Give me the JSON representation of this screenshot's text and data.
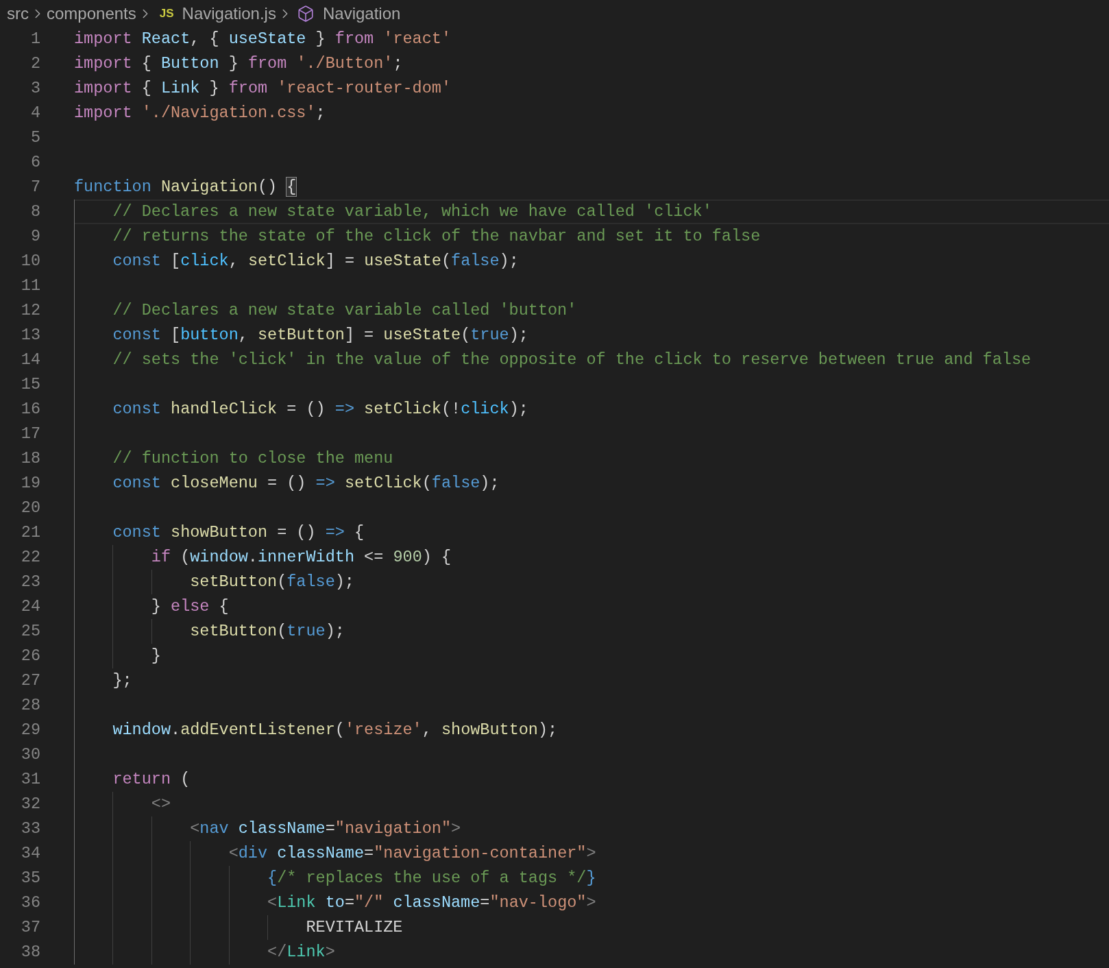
{
  "breadcrumbs": [
    {
      "kind": "folder",
      "label": "src"
    },
    {
      "kind": "folder",
      "label": "components"
    },
    {
      "kind": "file",
      "badge": "JS",
      "label": "Navigation.js"
    },
    {
      "kind": "symbol",
      "label": "Navigation"
    }
  ],
  "lines": [
    {
      "number": "1",
      "current": false,
      "tokens": [
        {
          "kind": "keyword",
          "text": "import "
        },
        {
          "kind": "variable",
          "text": "React"
        },
        {
          "kind": "plain",
          "text": ", { "
        },
        {
          "kind": "variable",
          "text": "useState"
        },
        {
          "kind": "plain",
          "text": " } "
        },
        {
          "kind": "keyword",
          "text": "from "
        },
        {
          "kind": "string",
          "text": "'react'"
        }
      ]
    },
    {
      "number": "2",
      "current": false,
      "tokens": [
        {
          "kind": "keyword",
          "text": "import "
        },
        {
          "kind": "plain",
          "text": "{ "
        },
        {
          "kind": "variable",
          "text": "Button"
        },
        {
          "kind": "plain",
          "text": " } "
        },
        {
          "kind": "keyword",
          "text": "from "
        },
        {
          "kind": "string",
          "text": "'./Button'"
        },
        {
          "kind": "plain",
          "text": ";"
        }
      ]
    },
    {
      "number": "3",
      "current": false,
      "tokens": [
        {
          "kind": "keyword",
          "text": "import "
        },
        {
          "kind": "plain",
          "text": "{ "
        },
        {
          "kind": "variable",
          "text": "Link"
        },
        {
          "kind": "plain",
          "text": " } "
        },
        {
          "kind": "keyword",
          "text": "from "
        },
        {
          "kind": "string",
          "text": "'react-router-dom'"
        }
      ]
    },
    {
      "number": "4",
      "current": false,
      "tokens": [
        {
          "kind": "keyword",
          "text": "import "
        },
        {
          "kind": "string",
          "text": "'./Navigation.css'"
        },
        {
          "kind": "plain",
          "text": ";"
        }
      ]
    },
    {
      "number": "5",
      "current": false
    },
    {
      "number": "6",
      "current": false
    },
    {
      "number": "7",
      "current": false,
      "tokens": [
        {
          "kind": "storage",
          "text": "function "
        },
        {
          "kind": "function",
          "text": "Navigation"
        },
        {
          "kind": "plain",
          "text": "() "
        },
        {
          "kind": "plain",
          "text": "{",
          "matched": true
        }
      ]
    },
    {
      "number": "8",
      "current": true,
      "guides": [
        {
          "active": true
        }
      ],
      "tokens": [
        {
          "kind": "comment",
          "text": "// Declares a new state variable, which we have called 'click'"
        }
      ]
    },
    {
      "number": "9",
      "current": false,
      "guides": [
        {
          "active": true
        }
      ],
      "tokens": [
        {
          "kind": "comment",
          "text": "// returns the state of the click of the navbar and set it to false"
        }
      ]
    },
    {
      "number": "10",
      "current": false,
      "guides": [
        {
          "active": true
        }
      ],
      "tokens": [
        {
          "kind": "storage",
          "text": "const "
        },
        {
          "kind": "plain",
          "text": "["
        },
        {
          "kind": "constant",
          "text": "click"
        },
        {
          "kind": "plain",
          "text": ", "
        },
        {
          "kind": "function",
          "text": "setClick"
        },
        {
          "kind": "plain",
          "text": "] = "
        },
        {
          "kind": "function",
          "text": "useState"
        },
        {
          "kind": "plain",
          "text": "("
        },
        {
          "kind": "storage",
          "text": "false"
        },
        {
          "kind": "plain",
          "text": ");"
        }
      ]
    },
    {
      "number": "11",
      "current": false,
      "guides": [
        {
          "active": true
        }
      ]
    },
    {
      "number": "12",
      "current": false,
      "guides": [
        {
          "active": true
        }
      ],
      "tokens": [
        {
          "kind": "comment",
          "text": "// Declares a new state variable called 'button'"
        }
      ]
    },
    {
      "number": "13",
      "current": false,
      "guides": [
        {
          "active": true
        }
      ],
      "tokens": [
        {
          "kind": "storage",
          "text": "const "
        },
        {
          "kind": "plain",
          "text": "["
        },
        {
          "kind": "constant",
          "text": "button"
        },
        {
          "kind": "plain",
          "text": ", "
        },
        {
          "kind": "function",
          "text": "setButton"
        },
        {
          "kind": "plain",
          "text": "] = "
        },
        {
          "kind": "function",
          "text": "useState"
        },
        {
          "kind": "plain",
          "text": "("
        },
        {
          "kind": "storage",
          "text": "true"
        },
        {
          "kind": "plain",
          "text": ");"
        }
      ]
    },
    {
      "number": "14",
      "current": false,
      "guides": [
        {
          "active": true
        }
      ],
      "tokens": [
        {
          "kind": "comment",
          "text": "// sets the 'click' in the value of the opposite of the click to reserve between true and false"
        }
      ]
    },
    {
      "number": "15",
      "current": false,
      "guides": [
        {
          "active": true
        }
      ]
    },
    {
      "number": "16",
      "current": false,
      "guides": [
        {
          "active": true
        }
      ],
      "tokens": [
        {
          "kind": "storage",
          "text": "const "
        },
        {
          "kind": "function",
          "text": "handleClick"
        },
        {
          "kind": "plain",
          "text": " = () "
        },
        {
          "kind": "storage",
          "text": "=> "
        },
        {
          "kind": "function",
          "text": "setClick"
        },
        {
          "kind": "plain",
          "text": "(!"
        },
        {
          "kind": "constant",
          "text": "click"
        },
        {
          "kind": "plain",
          "text": ");"
        }
      ]
    },
    {
      "number": "17",
      "current": false,
      "guides": [
        {
          "active": true
        }
      ]
    },
    {
      "number": "18",
      "current": false,
      "guides": [
        {
          "active": true
        }
      ],
      "tokens": [
        {
          "kind": "comment",
          "text": "// function to close the menu"
        }
      ]
    },
    {
      "number": "19",
      "current": false,
      "guides": [
        {
          "active": true
        }
      ],
      "tokens": [
        {
          "kind": "storage",
          "text": "const "
        },
        {
          "kind": "function",
          "text": "closeMenu"
        },
        {
          "kind": "plain",
          "text": " = () "
        },
        {
          "kind": "storage",
          "text": "=> "
        },
        {
          "kind": "function",
          "text": "setClick"
        },
        {
          "kind": "plain",
          "text": "("
        },
        {
          "kind": "storage",
          "text": "false"
        },
        {
          "kind": "plain",
          "text": ");"
        }
      ]
    },
    {
      "number": "20",
      "current": false,
      "guides": [
        {
          "active": true
        }
      ]
    },
    {
      "number": "21",
      "current": false,
      "guides": [
        {
          "active": true
        }
      ],
      "tokens": [
        {
          "kind": "storage",
          "text": "const "
        },
        {
          "kind": "function",
          "text": "showButton"
        },
        {
          "kind": "plain",
          "text": " = () "
        },
        {
          "kind": "storage",
          "text": "=>"
        },
        {
          "kind": "plain",
          "text": " {"
        }
      ]
    },
    {
      "number": "22",
      "current": false,
      "guides": [
        {
          "active": true
        },
        {
          "active": false
        }
      ],
      "tokens": [
        {
          "kind": "keyword",
          "text": "if "
        },
        {
          "kind": "plain",
          "text": "("
        },
        {
          "kind": "variable",
          "text": "window"
        },
        {
          "kind": "plain",
          "text": "."
        },
        {
          "kind": "variable",
          "text": "innerWidth"
        },
        {
          "kind": "plain",
          "text": " <= "
        },
        {
          "kind": "number",
          "text": "900"
        },
        {
          "kind": "plain",
          "text": ") {"
        }
      ]
    },
    {
      "number": "23",
      "current": false,
      "guides": [
        {
          "active": true
        },
        {
          "active": false
        },
        {
          "active": false
        }
      ],
      "tokens": [
        {
          "kind": "function",
          "text": "setButton"
        },
        {
          "kind": "plain",
          "text": "("
        },
        {
          "kind": "storage",
          "text": "false"
        },
        {
          "kind": "plain",
          "text": ");"
        }
      ]
    },
    {
      "number": "24",
      "current": false,
      "guides": [
        {
          "active": true
        },
        {
          "active": false
        }
      ],
      "tokens": [
        {
          "kind": "plain",
          "text": "} "
        },
        {
          "kind": "keyword",
          "text": "else "
        },
        {
          "kind": "plain",
          "text": "{"
        }
      ]
    },
    {
      "number": "25",
      "current": false,
      "guides": [
        {
          "active": true
        },
        {
          "active": false
        },
        {
          "active": false
        }
      ],
      "tokens": [
        {
          "kind": "function",
          "text": "setButton"
        },
        {
          "kind": "plain",
          "text": "("
        },
        {
          "kind": "storage",
          "text": "true"
        },
        {
          "kind": "plain",
          "text": ");"
        }
      ]
    },
    {
      "number": "26",
      "current": false,
      "guides": [
        {
          "active": true
        },
        {
          "active": false
        }
      ],
      "tokens": [
        {
          "kind": "plain",
          "text": "}"
        }
      ]
    },
    {
      "number": "27",
      "current": false,
      "guides": [
        {
          "active": true
        }
      ],
      "tokens": [
        {
          "kind": "plain",
          "text": "};"
        }
      ]
    },
    {
      "number": "28",
      "current": false,
      "guides": [
        {
          "active": true
        }
      ]
    },
    {
      "number": "29",
      "current": false,
      "guides": [
        {
          "active": true
        }
      ],
      "tokens": [
        {
          "kind": "variable",
          "text": "window"
        },
        {
          "kind": "plain",
          "text": "."
        },
        {
          "kind": "function",
          "text": "addEventListener"
        },
        {
          "kind": "plain",
          "text": "("
        },
        {
          "kind": "string",
          "text": "'resize'"
        },
        {
          "kind": "plain",
          "text": ", "
        },
        {
          "kind": "function",
          "text": "showButton"
        },
        {
          "kind": "plain",
          "text": ");"
        }
      ]
    },
    {
      "number": "30",
      "current": false,
      "guides": [
        {
          "active": true
        }
      ]
    },
    {
      "number": "31",
      "current": false,
      "guides": [
        {
          "active": true
        }
      ],
      "tokens": [
        {
          "kind": "keyword",
          "text": "return "
        },
        {
          "kind": "plain",
          "text": "("
        }
      ]
    },
    {
      "number": "32",
      "current": false,
      "guides": [
        {
          "active": true
        },
        {
          "active": false
        }
      ],
      "tokens": [
        {
          "kind": "tag-bracket",
          "text": "<>"
        }
      ]
    },
    {
      "number": "33",
      "current": false,
      "guides": [
        {
          "active": true
        },
        {
          "active": false
        },
        {
          "active": false
        }
      ],
      "tokens": [
        {
          "kind": "tag-bracket",
          "text": "<"
        },
        {
          "kind": "storage",
          "text": "nav "
        },
        {
          "kind": "variable",
          "text": "className"
        },
        {
          "kind": "plain",
          "text": "="
        },
        {
          "kind": "string",
          "text": "\"navigation\""
        },
        {
          "kind": "tag-bracket",
          "text": ">"
        }
      ]
    },
    {
      "number": "34",
      "current": false,
      "guides": [
        {
          "active": true
        },
        {
          "active": false
        },
        {
          "active": false
        },
        {
          "active": false
        }
      ],
      "tokens": [
        {
          "kind": "tag-bracket",
          "text": "<"
        },
        {
          "kind": "storage",
          "text": "div "
        },
        {
          "kind": "variable",
          "text": "className"
        },
        {
          "kind": "plain",
          "text": "="
        },
        {
          "kind": "string",
          "text": "\"navigation-container\""
        },
        {
          "kind": "tag-bracket",
          "text": ">"
        }
      ]
    },
    {
      "number": "35",
      "current": false,
      "guides": [
        {
          "active": true
        },
        {
          "active": false
        },
        {
          "active": false
        },
        {
          "active": false
        },
        {
          "active": false
        }
      ],
      "tokens": [
        {
          "kind": "storage",
          "text": "{"
        },
        {
          "kind": "comment",
          "text": "/* replaces the use of a tags */"
        },
        {
          "kind": "storage",
          "text": "}"
        }
      ]
    },
    {
      "number": "36",
      "current": false,
      "guides": [
        {
          "active": true
        },
        {
          "active": false
        },
        {
          "active": false
        },
        {
          "active": false
        },
        {
          "active": false
        }
      ],
      "tokens": [
        {
          "kind": "tag-bracket",
          "text": "<"
        },
        {
          "kind": "component",
          "text": "Link "
        },
        {
          "kind": "variable",
          "text": "to"
        },
        {
          "kind": "plain",
          "text": "="
        },
        {
          "kind": "string",
          "text": "\"/\" "
        },
        {
          "kind": "variable",
          "text": "className"
        },
        {
          "kind": "plain",
          "text": "="
        },
        {
          "kind": "string",
          "text": "\"nav-logo\""
        },
        {
          "kind": "tag-bracket",
          "text": ">"
        }
      ]
    },
    {
      "number": "37",
      "current": false,
      "guides": [
        {
          "active": true
        },
        {
          "active": false
        },
        {
          "active": false
        },
        {
          "active": false
        },
        {
          "active": false
        },
        {
          "active": false
        }
      ],
      "tokens": [
        {
          "kind": "plain",
          "text": "REVITALIZE"
        }
      ]
    },
    {
      "number": "38",
      "current": false,
      "guides": [
        {
          "active": true
        },
        {
          "active": false
        },
        {
          "active": false
        },
        {
          "active": false
        },
        {
          "active": false
        }
      ],
      "tokens": [
        {
          "kind": "tag-bracket",
          "text": "</"
        },
        {
          "kind": "component",
          "text": "Link"
        },
        {
          "kind": "tag-bracket",
          "text": ">"
        }
      ]
    }
  ]
}
